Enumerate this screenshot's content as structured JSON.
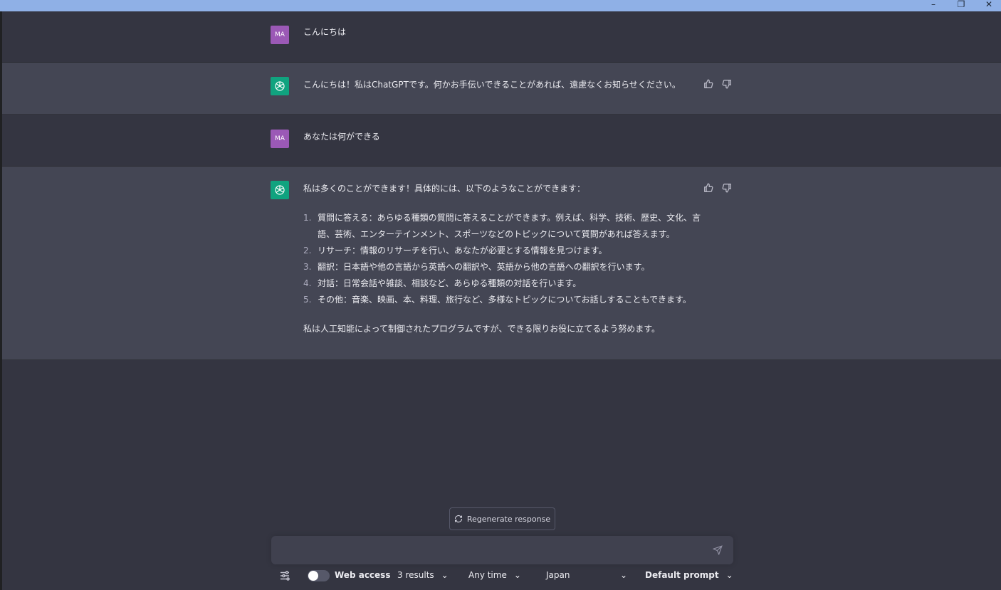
{
  "window": {
    "minimize_glyph": "–",
    "restore_glyph": "❐",
    "close_glyph": "✕"
  },
  "messages": [
    {
      "role": "user",
      "avatar": "MA",
      "text": "こんにちは"
    },
    {
      "role": "assistant",
      "text": "こんにちは！私はChatGPTです。何かお手伝いできることがあれば、遠慮なくお知らせください。"
    },
    {
      "role": "user",
      "avatar": "MA",
      "text": "あなたは何ができる"
    },
    {
      "role": "assistant",
      "intro": "私は多くのことができます！具体的には、以下のようなことができます：",
      "items": [
        {
          "num": "1.",
          "line1": "質問に答える：あらゆる種類の質問に答えることができます。例えば、科学、技術、歴史、文化、言",
          "line2": "語、芸術、エンターテインメント、スポーツなどのトピックについて質問があれば答えます。"
        },
        {
          "num": "2.",
          "line1": "リサーチ：情報のリサーチを行い、あなたが必要とする情報を見つけます。"
        },
        {
          "num": "3.",
          "line1": "翻訳：日本語や他の言語から英語への翻訳や、英語から他の言語への翻訳を行います。"
        },
        {
          "num": "4.",
          "line1": "対話：日常会話や雑談、相談など、あらゆる種類の対話を行います。"
        },
        {
          "num": "5.",
          "line1": "その他：音楽、映画、本、料理、旅行など、多様なトピックについてお話しすることもできます。"
        }
      ],
      "closing": "私は人工知能によって制御されたプログラムですが、できる限りお役に立てるよう努めます。"
    }
  ],
  "regenerate_label": "Regenerate response",
  "input": {
    "placeholder": ""
  },
  "toolbar": {
    "web_access_label": "Web access",
    "web_access_enabled": false,
    "results_label": "3 results",
    "time_label": "Any time",
    "region_label": "Japan",
    "prompt_label": "Default prompt"
  },
  "colors": {
    "background": "#343541",
    "assistant_row": "#444654",
    "user_avatar": "#9b59b6",
    "assistant_avatar": "#10a37f",
    "titlebar": "#8fb0e6"
  }
}
